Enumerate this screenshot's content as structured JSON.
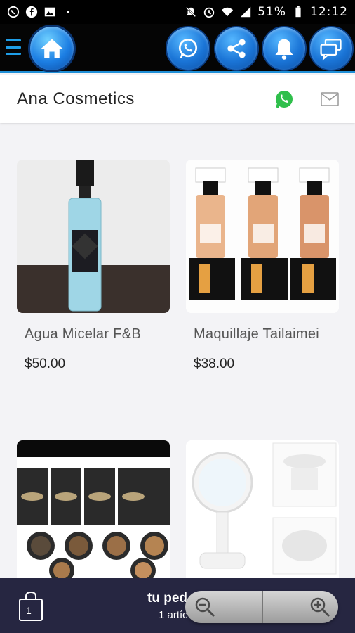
{
  "status_bar": {
    "battery_percent": "51%",
    "time": "12:12",
    "icons": [
      "whatsapp-status-icon",
      "facebook-icon",
      "image-icon",
      "dot-icon",
      "mute-icon",
      "alarm-icon",
      "wifi-icon",
      "signal-icon",
      "battery-icon"
    ]
  },
  "app_bar": {
    "buttons": [
      "menu-icon",
      "home-icon",
      "whatsapp-icon",
      "share-icon",
      "bell-icon",
      "chat-icon"
    ],
    "accent_color": "#1f8fd6"
  },
  "header": {
    "store_name": "Ana Cosmetics"
  },
  "products": [
    {
      "name": "Agua Micelar F&B",
      "price": "$50.00"
    },
    {
      "name": "Maquillaje Tailaimei",
      "price": "$38.00"
    },
    {
      "name": "",
      "price": ""
    },
    {
      "name": "",
      "price": ""
    }
  ],
  "order_bar": {
    "title": "tu ped",
    "count": "1 artíc",
    "bag_count": "1",
    "background": "#262641"
  }
}
